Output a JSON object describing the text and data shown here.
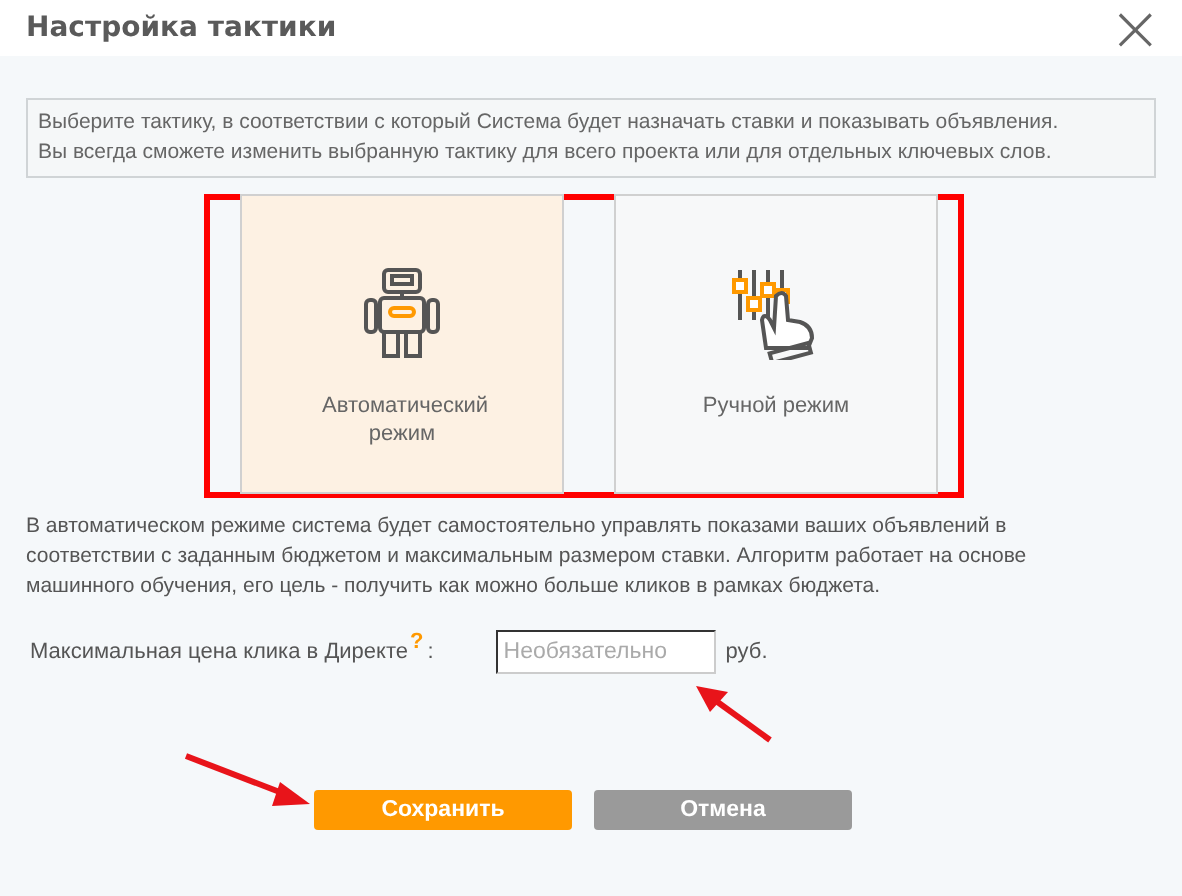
{
  "window": {
    "title": "Настройка тактики",
    "close": "×"
  },
  "intro": [
    "Выберите тактику, в соответствии с который Система будет назначать ставки и показывать объявления.",
    "Вы всегда сможете изменить выбранную тактику для всего проекта или для отдельных ключевых слов."
  ],
  "modes": [
    {
      "kind": "robot",
      "label": "Автоматический режим",
      "selected": true
    },
    {
      "kind": "sliders",
      "label": "Ручной режим",
      "selected": false
    }
  ],
  "description": "В автоматическом режиме система будет самостоятельно управлять показами ваших объявлений в соответствии с заданным бюджетом и максимальным размером ставки. Алгоритм работает на основе машинного обучения, его цель - получить как можно больше кликов в рамках бюджета.",
  "max_cpc": {
    "label": "Максимальная цена клика в Директе",
    "help": "?",
    "colon": ":",
    "placeholder": "Необязательно",
    "unit": "руб."
  },
  "buttons": [
    {
      "kind": "primary",
      "label": "Сохранить"
    },
    {
      "kind": "secondary",
      "label": "Отмена"
    }
  ]
}
